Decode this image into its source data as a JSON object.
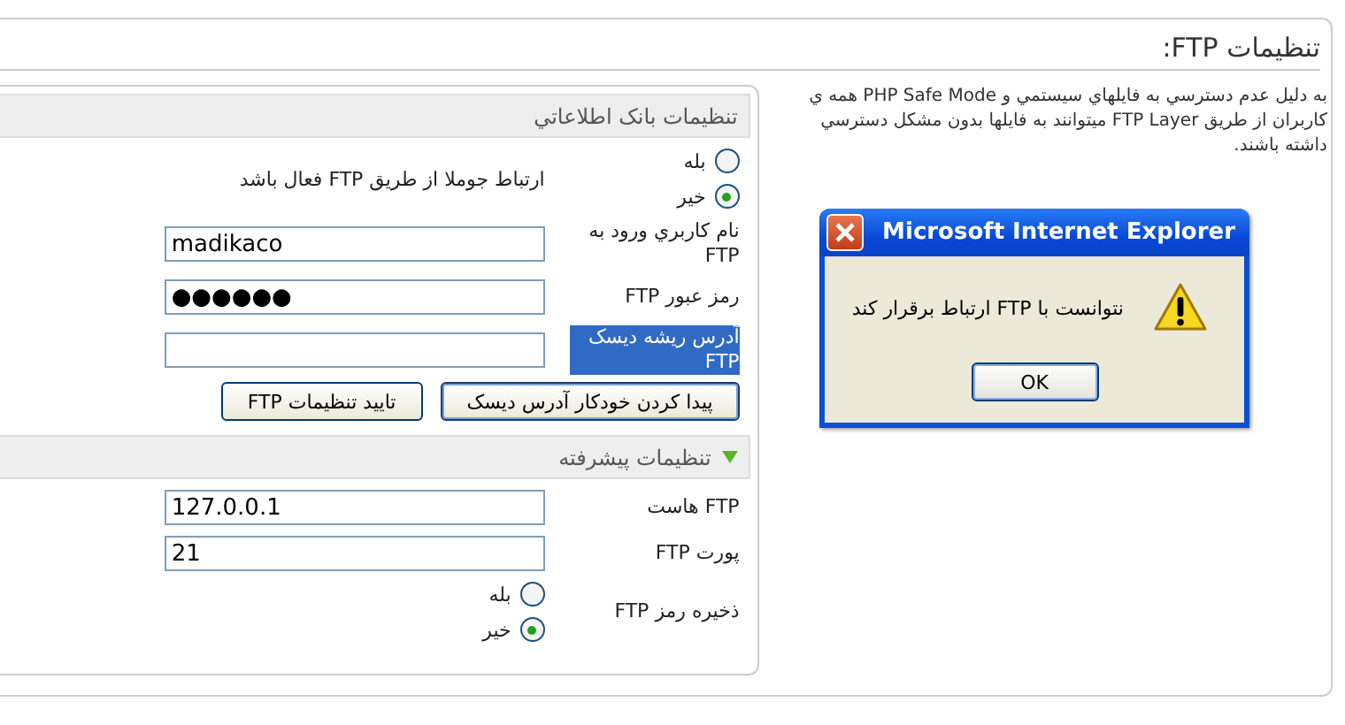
{
  "page_title": "تنظیمات FTP:",
  "description": "به دليل عدم دسترسي به فايلهاي سيستمي و PHP Safe Mode همه ي کاربران از طريق FTP Layer ميتوانند به فايلها بدون مشکل دسترسي داشته باشند.",
  "panel": {
    "header": "تنظيمات بانک اطلاعاتي",
    "rows": [
      {
        "kind": "radio",
        "options": [
          {
            "label": "بله",
            "selected": false
          },
          {
            "label": "خير",
            "selected": true
          }
        ],
        "note": "ارتباط جوملا از طريق FTP فعال باشد"
      },
      {
        "kind": "text",
        "label": "نام کاربري ورود به FTP",
        "value": "madikaco",
        "highlighted": false
      },
      {
        "kind": "password",
        "label": "رمز عبور FTP",
        "value": "●●●●●●",
        "highlighted": false
      },
      {
        "kind": "text",
        "label": "آدرس ريشه ديسک FTP",
        "highlighted": true
      }
    ],
    "buttons": [
      {
        "label": "پيدا کردن خودکار آدرس ديسک",
        "focused": true
      },
      {
        "label": "تاييد تنظيمات FTP",
        "focused": false
      }
    ]
  },
  "advanced": {
    "header": "تنظيمات پيشرفته",
    "expanded": true,
    "rows": [
      {
        "kind": "text",
        "label": "FTP هاست",
        "value": "127.0.0.1",
        "highlighted": false
      },
      {
        "kind": "text",
        "label": "پورت FTP",
        "value": "21",
        "highlighted": false
      },
      {
        "kind": "radio",
        "label": "ذخيره رمز FTP",
        "options": [
          {
            "label": "بله",
            "selected": false
          },
          {
            "label": "خير",
            "selected": true
          }
        ]
      }
    ]
  },
  "dialog": {
    "title": "Microsoft Internet Explorer",
    "message": "نتوانست با FTP ارتباط برقرار کند",
    "button": "OK"
  }
}
